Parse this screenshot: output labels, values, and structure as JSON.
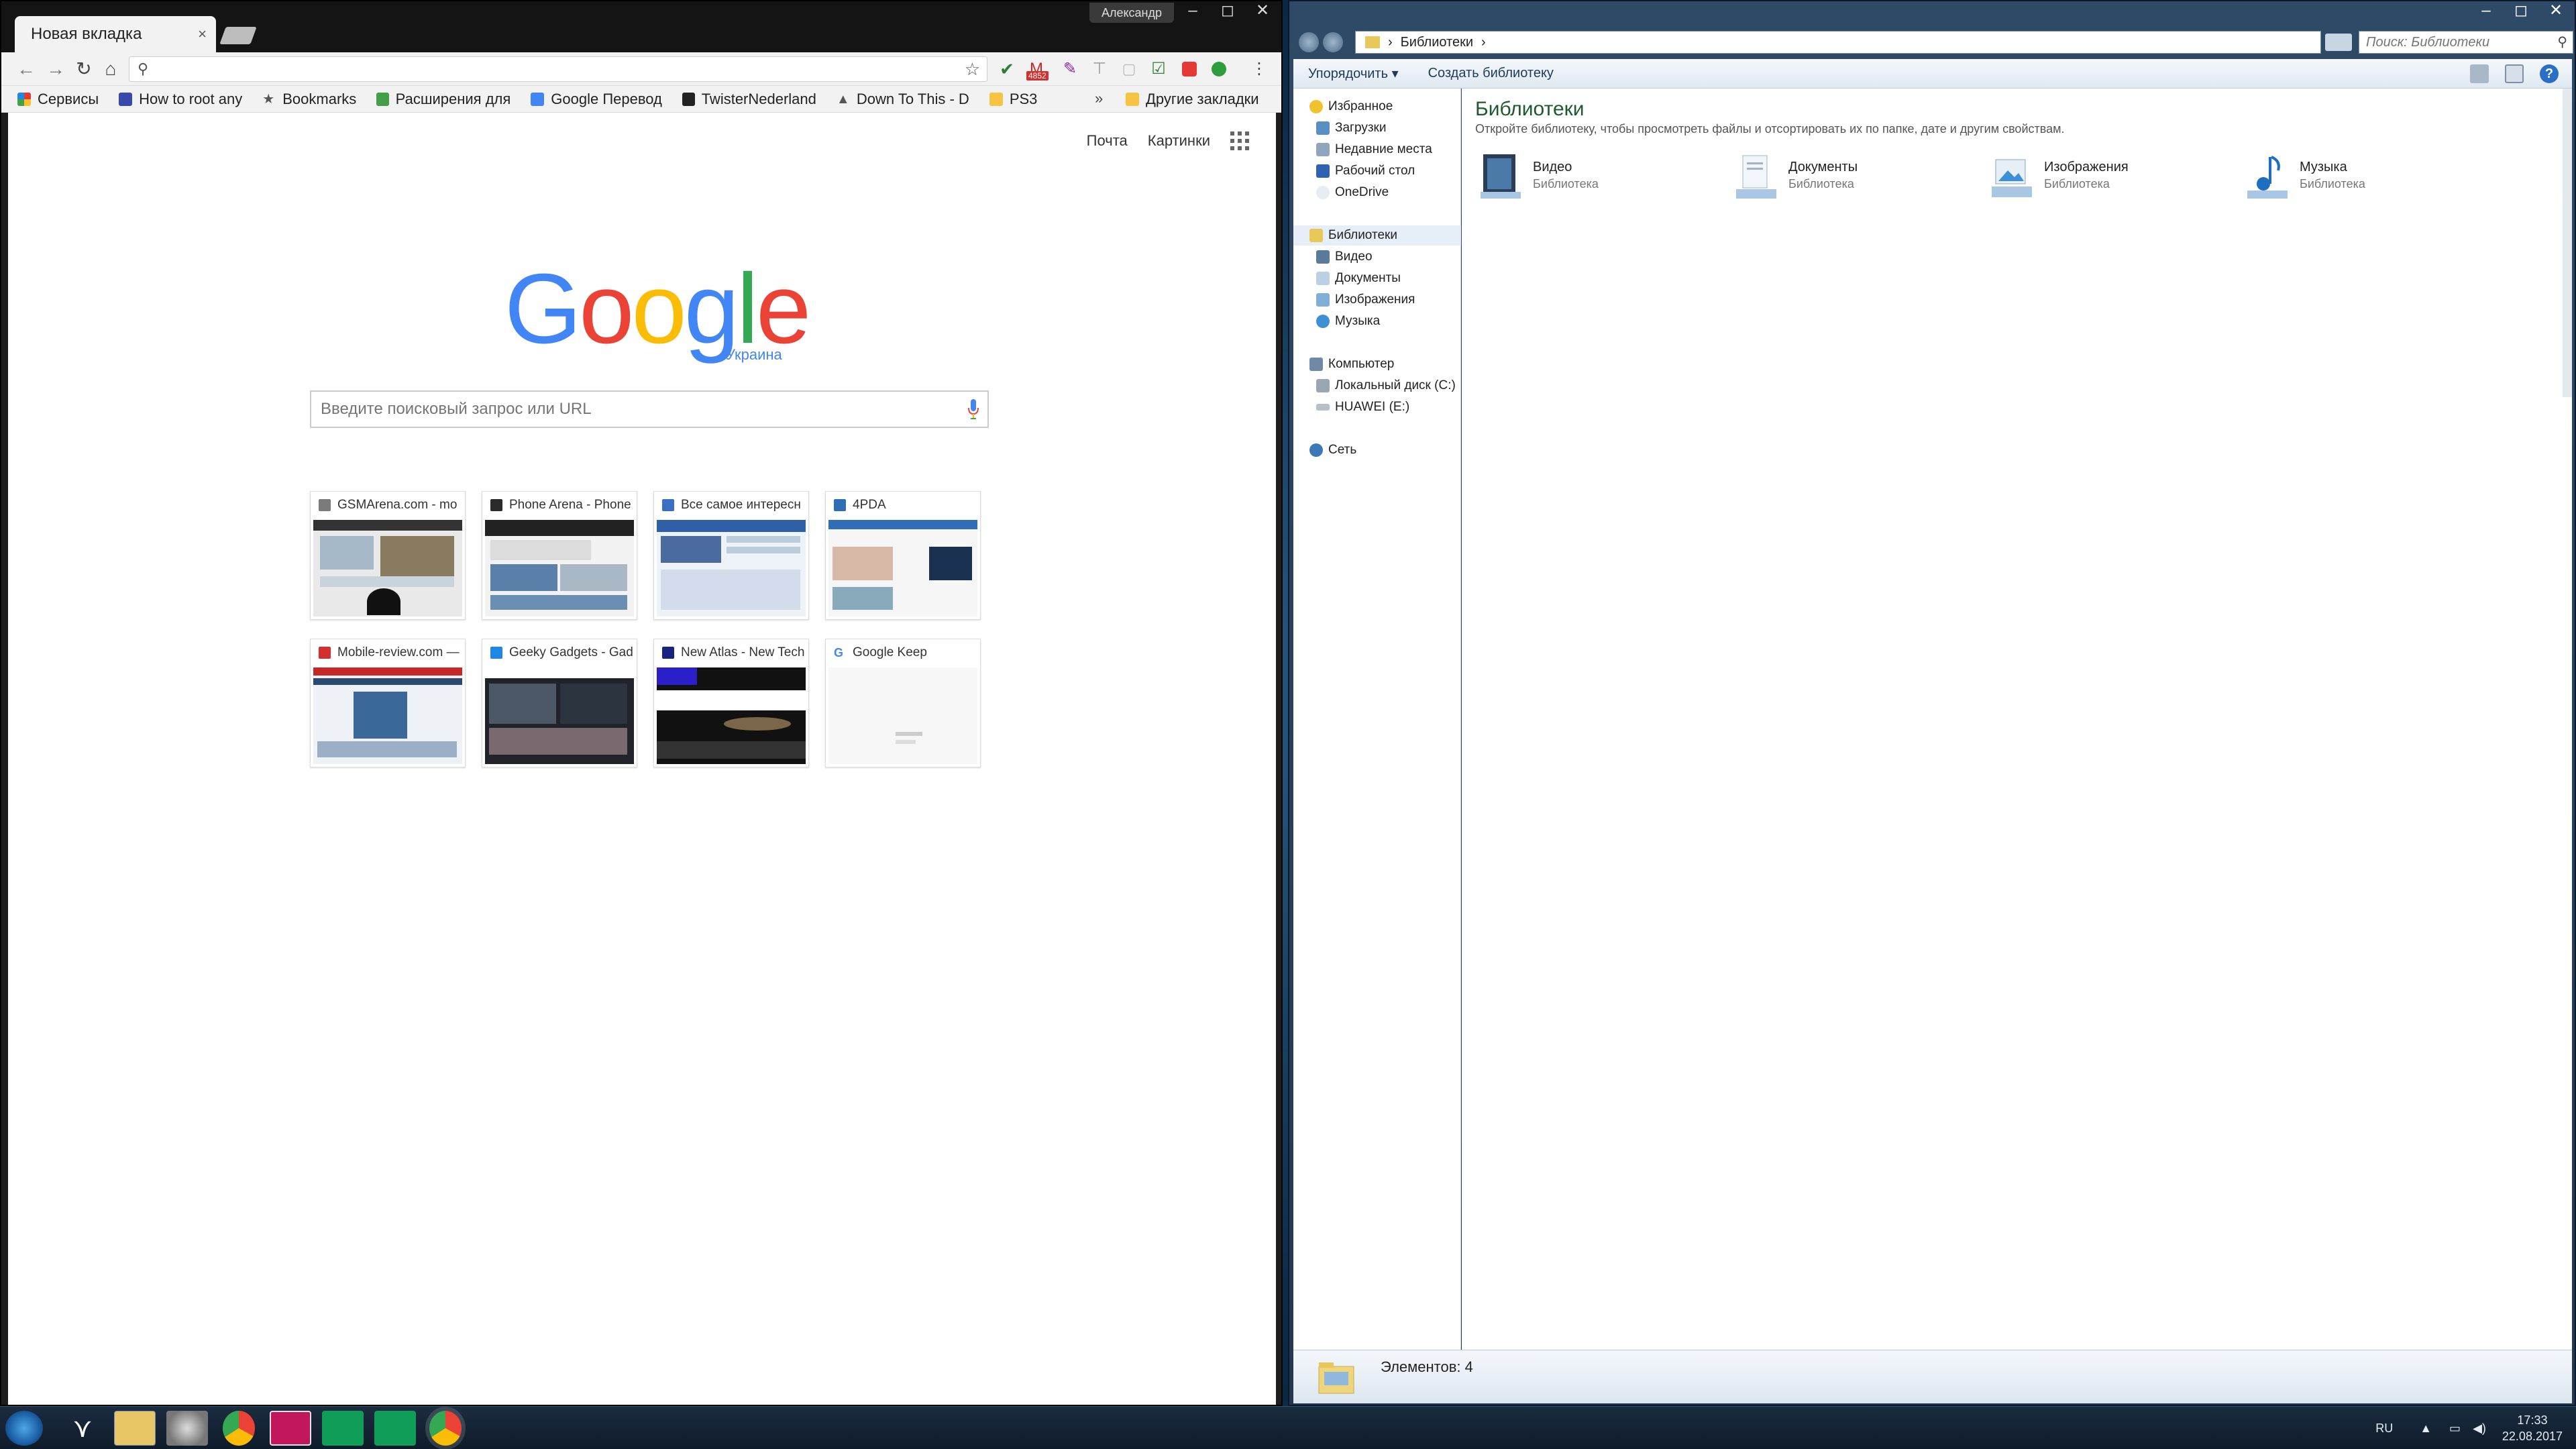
{
  "chrome": {
    "tab_title": "Новая вкладка",
    "tab_close": "×",
    "profile_name": "Александр",
    "window_controls": {
      "minimize": "–",
      "maximize": "◻",
      "close": "✕"
    },
    "omnibox_value": "",
    "bookmarks": [
      {
        "label": "Сервисы",
        "icon_color": "#e53935"
      },
      {
        "label": "How to root any",
        "icon_color": "#3949ab"
      },
      {
        "label": "Bookmarks",
        "icon_color": "#555555"
      },
      {
        "label": "Расширения для",
        "icon_color": "#43a047"
      },
      {
        "label": "Google Перевод",
        "icon_color": "#4285f4"
      },
      {
        "label": "TwisterNederland",
        "icon_color": "#222222"
      },
      {
        "label": "Down To This - D",
        "icon_color": "#555555"
      },
      {
        "label": "PS3",
        "icon_color": "#f6c343"
      }
    ],
    "bookmarks_overflow": "»",
    "other_bookmarks": "Другие закладки",
    "extension_badge": "4852"
  },
  "ntp": {
    "link_mail": "Почта",
    "link_images": "Картинки",
    "logo": {
      "g1": "G",
      "o1": "o",
      "o2": "o",
      "g2": "g",
      "l": "l",
      "e": "e"
    },
    "region": "Украина",
    "search_placeholder": "Введите поисковый запрос или URL",
    "tiles": [
      {
        "title": "GSMArena.com - mo",
        "favicon_color": "#7b7b7b"
      },
      {
        "title": "Phone Arena - Phone",
        "favicon_color": "#2b2b2b"
      },
      {
        "title": "Все самое интересн",
        "favicon_color": "#3a6fc4"
      },
      {
        "title": "4PDA",
        "favicon_color": "#2f6db5"
      },
      {
        "title": "Mobile-review.com —",
        "favicon_color": "#d32f2f"
      },
      {
        "title": "Geeky Gadgets - Gad",
        "favicon_color": "#1e88e5"
      },
      {
        "title": "New Atlas - New Tech",
        "favicon_color": "#1a237e"
      },
      {
        "title": "Google Keep",
        "favicon_color": "#4285f4"
      }
    ]
  },
  "explorer": {
    "breadcrumb": "Библиотеки",
    "search_placeholder": "Поиск: Библиотеки",
    "commands": {
      "organize": "Упорядочить ▾",
      "create_library": "Создать библиотеку"
    },
    "nav": {
      "favorites": "Избранное",
      "downloads": "Загрузки",
      "recent": "Недавние места",
      "desktop": "Рабочий стол",
      "onedrive": "OneDrive",
      "libraries": "Библиотеки",
      "lib_video": "Видео",
      "lib_docs": "Документы",
      "lib_images": "Изображения",
      "lib_music": "Музыка",
      "computer": "Компьютер",
      "local_disk": "Локальный диск (C:)",
      "huawei": "HUAWEI (E:)",
      "network": "Сеть"
    },
    "main_title": "Библиотеки",
    "main_desc": "Откройте библиотеку, чтобы просмотреть файлы и отсортировать их по папке, дате и другим свойствам.",
    "libraries": [
      {
        "name": "Видео",
        "type": "Библиотека"
      },
      {
        "name": "Документы",
        "type": "Библиотека"
      },
      {
        "name": "Изображения",
        "type": "Библиотека"
      },
      {
        "name": "Музыка",
        "type": "Библиотека"
      }
    ],
    "status": "Элементов: 4"
  },
  "taskbar": {
    "language": "RU",
    "time": "17:33",
    "date": "22.08.2017"
  }
}
